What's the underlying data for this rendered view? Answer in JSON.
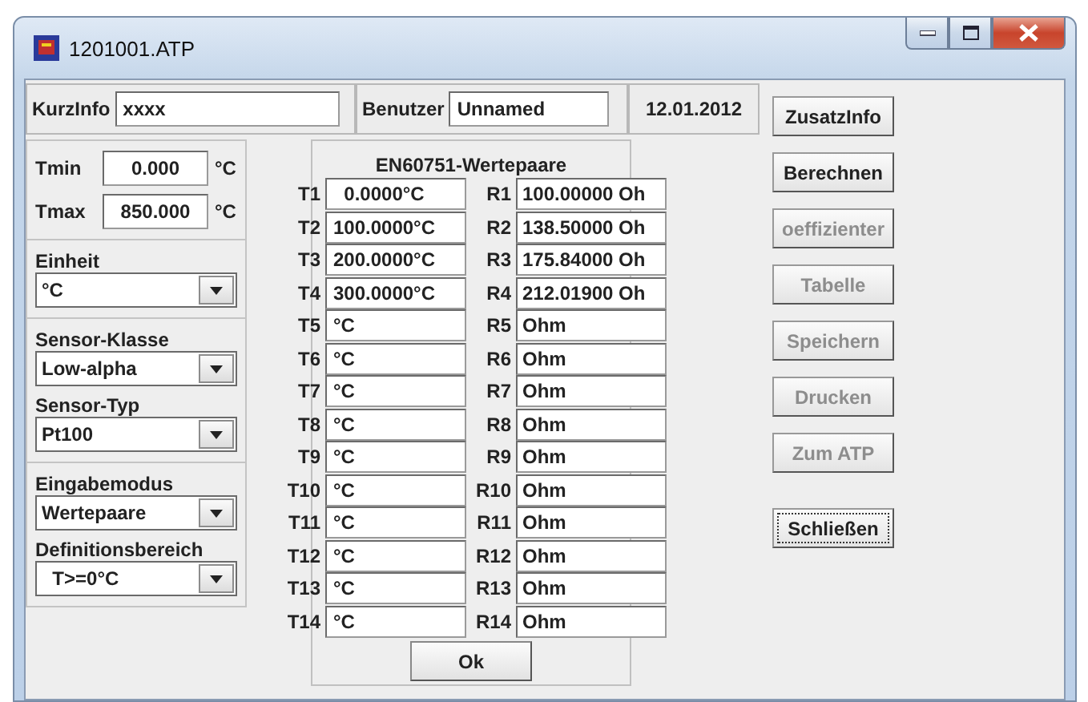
{
  "window": {
    "title": "1201001.ATP"
  },
  "header": {
    "kurzinfo": {
      "label": "KurzInfo",
      "value": "xxxx"
    },
    "benutzer": {
      "label": "Benutzer",
      "value": "Unnamed"
    },
    "date": "12.01.2012"
  },
  "range": [
    {
      "label": "Tmin",
      "value": "0.000",
      "unit": "°C"
    },
    {
      "label": "Tmax",
      "value": "850.000",
      "unit": "°C"
    }
  ],
  "settings": [
    {
      "fields": [
        {
          "label": "Einheit",
          "value": "°C"
        }
      ]
    },
    {
      "fields": [
        {
          "label": "Sensor-Klasse",
          "value": "Low-alpha"
        },
        {
          "label": "Sensor-Typ",
          "value": "Pt100"
        }
      ]
    },
    {
      "fields": [
        {
          "label": "Eingabemodus",
          "value": "Wertepaare"
        },
        {
          "label": "Definitionsbereich",
          "value": "  T>=0°C"
        }
      ]
    }
  ],
  "pairs": {
    "title": "EN60751-Wertepaare",
    "ok_button": "Ok",
    "rows": [
      {
        "t_label": "T1",
        "t_value": "  0.0000°C",
        "r_label": "R1",
        "r_value": "100.00000 Oh"
      },
      {
        "t_label": "T2",
        "t_value": "100.0000°C",
        "r_label": "R2",
        "r_value": "138.50000 Oh"
      },
      {
        "t_label": "T3",
        "t_value": "200.0000°C",
        "r_label": "R3",
        "r_value": "175.84000 Oh"
      },
      {
        "t_label": "T4",
        "t_value": "300.0000°C",
        "r_label": "R4",
        "r_value": "212.01900 Oh"
      },
      {
        "t_label": "T5",
        "t_value": "°C",
        "r_label": "R5",
        "r_value": "Ohm"
      },
      {
        "t_label": "T6",
        "t_value": "°C",
        "r_label": "R6",
        "r_value": "Ohm"
      },
      {
        "t_label": "T7",
        "t_value": "°C",
        "r_label": "R7",
        "r_value": "Ohm"
      },
      {
        "t_label": "T8",
        "t_value": "°C",
        "r_label": "R8",
        "r_value": "Ohm"
      },
      {
        "t_label": "T9",
        "t_value": "°C",
        "r_label": "R9",
        "r_value": "Ohm"
      },
      {
        "t_label": "T10",
        "t_value": "°C",
        "r_label": "R10",
        "r_value": "Ohm"
      },
      {
        "t_label": "T11",
        "t_value": "°C",
        "r_label": "R11",
        "r_value": "Ohm"
      },
      {
        "t_label": "T12",
        "t_value": "°C",
        "r_label": "R12",
        "r_value": "Ohm"
      },
      {
        "t_label": "T13",
        "t_value": "°C",
        "r_label": "R13",
        "r_value": "Ohm"
      },
      {
        "t_label": "T14",
        "t_value": "°C",
        "r_label": "R14",
        "r_value": "Ohm"
      }
    ]
  },
  "buttons": [
    {
      "label": "ZusatzInfo",
      "disabled": false,
      "focused": false
    },
    {
      "label": "Berechnen",
      "disabled": false,
      "focused": false
    },
    {
      "label": "oeffizienter",
      "disabled": true,
      "focused": false
    },
    {
      "label": "Tabelle",
      "disabled": true,
      "focused": false
    },
    {
      "label": "Speichern",
      "disabled": true,
      "focused": false
    },
    {
      "label": "Drucken",
      "disabled": true,
      "focused": false
    },
    {
      "label": "Zum ATP",
      "disabled": true,
      "focused": false
    },
    {
      "label": "Schließen",
      "disabled": false,
      "focused": true
    }
  ]
}
